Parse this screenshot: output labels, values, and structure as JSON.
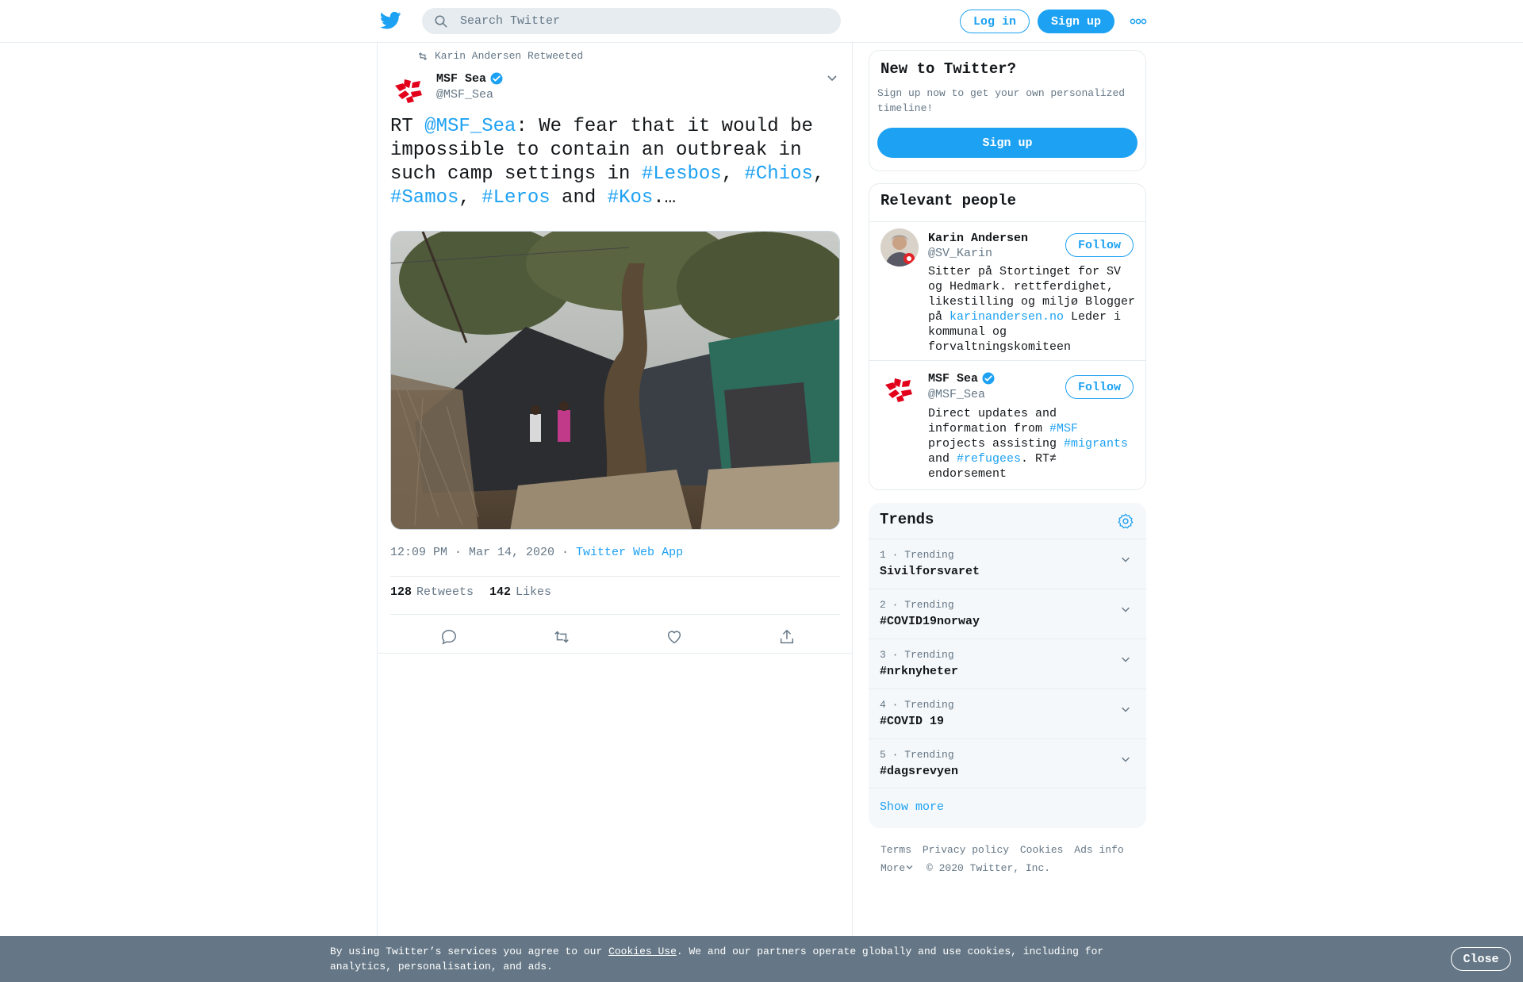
{
  "header": {
    "search_placeholder": "Search Twitter",
    "login_label": "Log in",
    "signup_label": "Sign up"
  },
  "tweet": {
    "retweeted_by": "Karin Andersen Retweeted",
    "author_name": "MSF Sea",
    "author_handle": "@MSF_Sea",
    "text_parts": [
      {
        "t": "RT ",
        "link": false
      },
      {
        "t": "@MSF_Sea",
        "link": true
      },
      {
        "t": ": We fear that it would be impossible to contain an outbreak in such camp settings in ",
        "link": false
      },
      {
        "t": "#Lesbos",
        "link": true
      },
      {
        "t": ", ",
        "link": false
      },
      {
        "t": "#Chios",
        "link": true
      },
      {
        "t": ", ",
        "link": false
      },
      {
        "t": "#Samos",
        "link": true
      },
      {
        "t": ", ",
        "link": false
      },
      {
        "t": "#Leros",
        "link": true
      },
      {
        "t": " and ",
        "link": false
      },
      {
        "t": "#Kos",
        "link": true
      },
      {
        "t": ".…",
        "link": false
      }
    ],
    "time": "12:09 PM · Mar 14, 2020 · ",
    "source": "Twitter Web App",
    "retweets_count": "128",
    "retweets_label": "Retweets",
    "likes_count": "142",
    "likes_label": "Likes"
  },
  "new_to_twitter": {
    "title": "New to Twitter?",
    "text": "Sign up now to get your own personalized timeline!",
    "button": "Sign up"
  },
  "relevant_people": {
    "title": "Relevant people",
    "people": [
      {
        "name": "Karin Andersen",
        "handle": "@SV_Karin",
        "follow": "Follow",
        "bio_parts": [
          {
            "t": "Sitter på Stortinget for SV og Hedmark. rettferdighet, likestilling og miljø Blogger på ",
            "link": false
          },
          {
            "t": "karinandersen.no",
            "link": true
          },
          {
            "t": " Leder i kommunal og forvaltningskomiteen",
            "link": false
          }
        ]
      },
      {
        "name": "MSF Sea",
        "handle": "@MSF_Sea",
        "follow": "Follow",
        "bio_parts": [
          {
            "t": "Direct updates and information from ",
            "link": false
          },
          {
            "t": "#MSF",
            "link": true
          },
          {
            "t": " projects assisting ",
            "link": false
          },
          {
            "t": "#migrants",
            "link": true
          },
          {
            "t": " and ",
            "link": false
          },
          {
            "t": "#refugees",
            "link": true
          },
          {
            "t": ". RT≠ endorsement",
            "link": false
          }
        ]
      }
    ]
  },
  "trends": {
    "title": "Trends",
    "items": [
      {
        "meta": "1 · Trending",
        "name": "Sivilforsvaret"
      },
      {
        "meta": "2 · Trending",
        "name": "#COVID19norway"
      },
      {
        "meta": "3 · Trending",
        "name": "#nrknyheter"
      },
      {
        "meta": "4 · Trending",
        "name": "#COVID⁠ 19"
      },
      {
        "meta": "5 · Trending",
        "name": "#dagsrevyen"
      }
    ],
    "show_more": "Show more"
  },
  "footer": {
    "links": [
      "Terms",
      "Privacy policy",
      "Cookies",
      "Ads info"
    ],
    "more": "More",
    "copyright": "© 2020 Twitter, Inc."
  },
  "cookie_banner": {
    "text_before": "By using Twitter’s services you agree to our ",
    "link": "Cookies Use",
    "text_after": ". We and our partners operate globally and use cookies, including for analytics, personalisation, and ads.",
    "close": "Close"
  },
  "colors": {
    "accent": "#1da1f2",
    "muted": "#657786",
    "banner": "#657786"
  }
}
